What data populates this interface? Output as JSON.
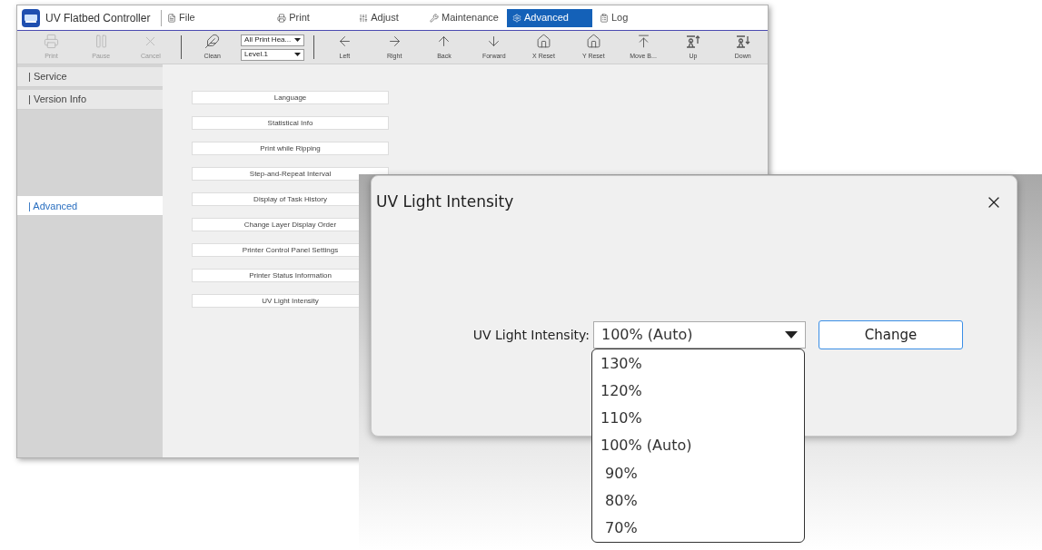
{
  "window": {
    "title": "UV Flatbed Controller"
  },
  "menu_tabs": [
    {
      "label": "File",
      "selected": false
    },
    {
      "label": "Print",
      "selected": false
    },
    {
      "label": "Adjust",
      "selected": false
    },
    {
      "label": "Maintenance",
      "selected": false
    },
    {
      "label": "Advanced",
      "selected": true
    },
    {
      "label": "Log",
      "selected": false
    }
  ],
  "toolbar": [
    {
      "kind": "button",
      "label": "Print",
      "disabled": true
    },
    {
      "kind": "button",
      "label": "Pause",
      "disabled": true
    },
    {
      "kind": "button",
      "label": "Cancel",
      "disabled": true
    },
    {
      "kind": "separator"
    },
    {
      "kind": "button",
      "label": "Clean",
      "disabled": false
    },
    {
      "kind": "selects",
      "values": [
        "All Print Hea...",
        "Level.1"
      ]
    },
    {
      "kind": "separator"
    },
    {
      "kind": "button",
      "label": "Left",
      "disabled": false
    },
    {
      "kind": "button",
      "label": "Right",
      "disabled": false
    },
    {
      "kind": "button",
      "label": "Back",
      "disabled": false
    },
    {
      "kind": "button",
      "label": "Forward",
      "disabled": false
    },
    {
      "kind": "button",
      "label": "X Reset",
      "disabled": false
    },
    {
      "kind": "button",
      "label": "Y Reset",
      "disabled": false
    },
    {
      "kind": "button",
      "label": "Move B...",
      "disabled": false
    },
    {
      "kind": "button",
      "label": "Up",
      "disabled": false
    },
    {
      "kind": "button",
      "label": "Down",
      "disabled": false
    }
  ],
  "sidebar": {
    "groups": [
      [
        {
          "label": "| Service",
          "selected": false
        },
        {
          "label": "| Version Info",
          "selected": false
        }
      ],
      [
        {
          "label": "| Advanced",
          "selected": true
        }
      ]
    ]
  },
  "settings_buttons": [
    "Language",
    "Statistical Info",
    "Print while Ripping",
    "Step-and-Repeat Interval",
    "Display of Task History",
    "Change Layer Display Order",
    "Printer Control Panel Settings",
    "Printer Status Information",
    "UV Light Intensity"
  ],
  "dialog": {
    "title": "UV Light Intensity",
    "field_label": "UV Light Intensity:",
    "value": "100% (Auto)",
    "button": "Change",
    "options": [
      "130%",
      "120%",
      "110%",
      "100% (Auto)",
      " 90%",
      " 80%",
      " 70%"
    ]
  }
}
